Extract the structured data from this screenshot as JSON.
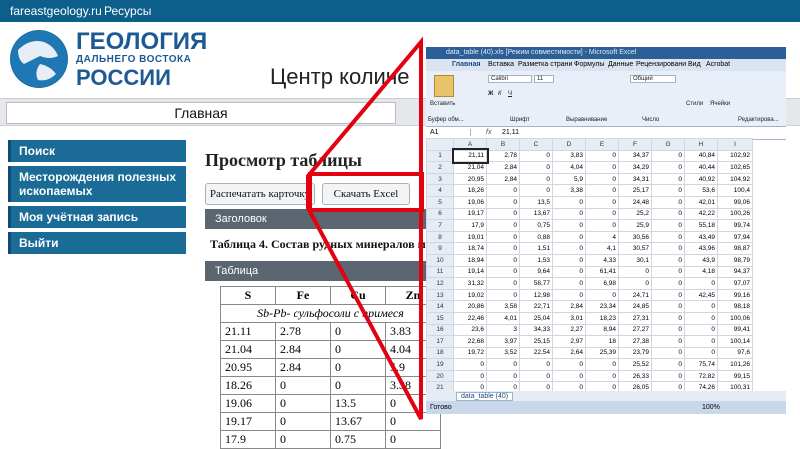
{
  "topbar": {
    "site": "fareastgeology.ru",
    "resources": "Ресурсы"
  },
  "logo": {
    "line1": "ГЕОЛОГИЯ",
    "line2": "ДАЛЬНЕГО ВОСТОКА",
    "line3": "РОССИИ"
  },
  "header": {
    "center_title": "Центр количе"
  },
  "nav": {
    "main": "Главная"
  },
  "sidebar": {
    "items": [
      "Поиск",
      "Месторождения полезных ископаемых",
      "Моя учётная запись",
      "Выйти"
    ]
  },
  "page": {
    "title": "Просмотр таблицы",
    "print_button": "Распечатать карточку",
    "excel_button": "Скачать Excel",
    "header_section": "Заголовок",
    "caption": "Таблица 4. Состав рудных минералов мест",
    "table_section": "Таблица"
  },
  "data_table": {
    "columns": [
      "S",
      "Fe",
      "Cu",
      "Zn"
    ],
    "group": "Sb-Pb- сульфосоли с примеся",
    "rows": [
      [
        "21.11",
        "2.78",
        "0",
        "3.83"
      ],
      [
        "21.04",
        "2.84",
        "0",
        "4.04"
      ],
      [
        "20.95",
        "2.84",
        "0",
        "5.9"
      ],
      [
        "18.26",
        "0",
        "0",
        "3.38"
      ],
      [
        "19.06",
        "0",
        "13.5",
        "0"
      ],
      [
        "19.17",
        "0",
        "13.67",
        "0"
      ],
      [
        "17.9",
        "0",
        "0.75",
        "0"
      ]
    ]
  },
  "excel": {
    "title": "data_table (40).xls [Режим совместимости] - Microsoft Excel",
    "tabs": [
      "Главная",
      "Вставка",
      "Разметка страни",
      "Формулы",
      "Данные",
      "Рецензировани",
      "Вид",
      "Acrobat"
    ],
    "ribbon": {
      "paste": "Вставить",
      "clipboard": "Буфер обм...",
      "font": "Шрифт",
      "font_name": "Calibri",
      "font_size": "11",
      "alignment": "Выравнивание",
      "number": "Число",
      "number_format": "Общий",
      "styles": "Стили",
      "cells": "Ячейки",
      "editing": "Редактирова..."
    },
    "name_box": "A1",
    "formula_value": "21,11",
    "col_headers": [
      "A",
      "B",
      "C",
      "D",
      "E",
      "F",
      "G",
      "H",
      "I"
    ],
    "rows": [
      [
        "21,11",
        "2,78",
        "0",
        "3,83",
        "0",
        "34,37",
        "0",
        "40,84",
        "102,92"
      ],
      [
        "21,04",
        "2,84",
        "0",
        "4,04",
        "0",
        "34,29",
        "0",
        "40,44",
        "102,65"
      ],
      [
        "20,95",
        "2,84",
        "0",
        "5,9",
        "0",
        "34,31",
        "0",
        "40,92",
        "104,92"
      ],
      [
        "18,26",
        "0",
        "0",
        "3,38",
        "0",
        "25,17",
        "0",
        "53,6",
        "100,4"
      ],
      [
        "19,06",
        "0",
        "13,5",
        "0",
        "0",
        "24,48",
        "0",
        "42,01",
        "99,06"
      ],
      [
        "19,17",
        "0",
        "13,67",
        "0",
        "0",
        "25,2",
        "0",
        "42,22",
        "100,26"
      ],
      [
        "17,9",
        "0",
        "0,75",
        "0",
        "0",
        "25,9",
        "0",
        "55,18",
        "99,74"
      ],
      [
        "19,01",
        "0",
        "0,88",
        "0",
        "4",
        "30,56",
        "0",
        "43,49",
        "97,94"
      ],
      [
        "18,74",
        "0",
        "1,51",
        "0",
        "4,1",
        "30,57",
        "0",
        "43,96",
        "98,87"
      ],
      [
        "18,94",
        "0",
        "1,53",
        "0",
        "4,33",
        "30,1",
        "0",
        "43,9",
        "98,79"
      ],
      [
        "19,14",
        "0",
        "9,64",
        "0",
        "61,41",
        "0",
        "0",
        "4,18",
        "94,37"
      ],
      [
        "31,32",
        "0",
        "58,77",
        "0",
        "6,98",
        "0",
        "0",
        "0",
        "97,07"
      ],
      [
        "19,02",
        "0",
        "12,98",
        "0",
        "0",
        "24,71",
        "0",
        "42,45",
        "99,16"
      ],
      [
        "20,86",
        "3,58",
        "22,71",
        "2,84",
        "23,34",
        "24,85",
        "0",
        "0",
        "98,18"
      ],
      [
        "22,46",
        "4,01",
        "25,04",
        "3,01",
        "18,23",
        "27,31",
        "0",
        "0",
        "100,06"
      ],
      [
        "23,6",
        "3",
        "34,33",
        "2,27",
        "8,94",
        "27,27",
        "0",
        "0",
        "99,41"
      ],
      [
        "22,68",
        "3,97",
        "25,15",
        "2,97",
        "18",
        "27,38",
        "0",
        "0",
        "100,14"
      ],
      [
        "19,72",
        "3,52",
        "22,54",
        "2,64",
        "25,39",
        "23,79",
        "0",
        "0",
        "97,6"
      ],
      [
        "0",
        "0",
        "0",
        "0",
        "0",
        "25,52",
        "0",
        "75,74",
        "101,26"
      ],
      [
        "0",
        "0",
        "0",
        "0",
        "0",
        "26,33",
        "0",
        "72,82",
        "99,15"
      ],
      [
        "0",
        "0",
        "0",
        "0",
        "0",
        "26,05",
        "0",
        "74,26",
        "100,31"
      ],
      [
        "0",
        "0",
        "0",
        "0",
        "0",
        "25,9",
        "0",
        "74,32",
        "100,22"
      ],
      [
        "0",
        "0",
        "0",
        "0",
        "0",
        "24,32",
        "0",
        "76,74",
        "101,06"
      ],
      [
        "0",
        "0",
        "0",
        "0",
        "0",
        "26,65",
        "0",
        "75,2",
        "101,85"
      ]
    ],
    "sheet_tab": "data_table (40)",
    "status": "Готово",
    "zoom": "100%"
  },
  "colors": {
    "accent": "#0b5f8a",
    "frame": "#e30010"
  }
}
